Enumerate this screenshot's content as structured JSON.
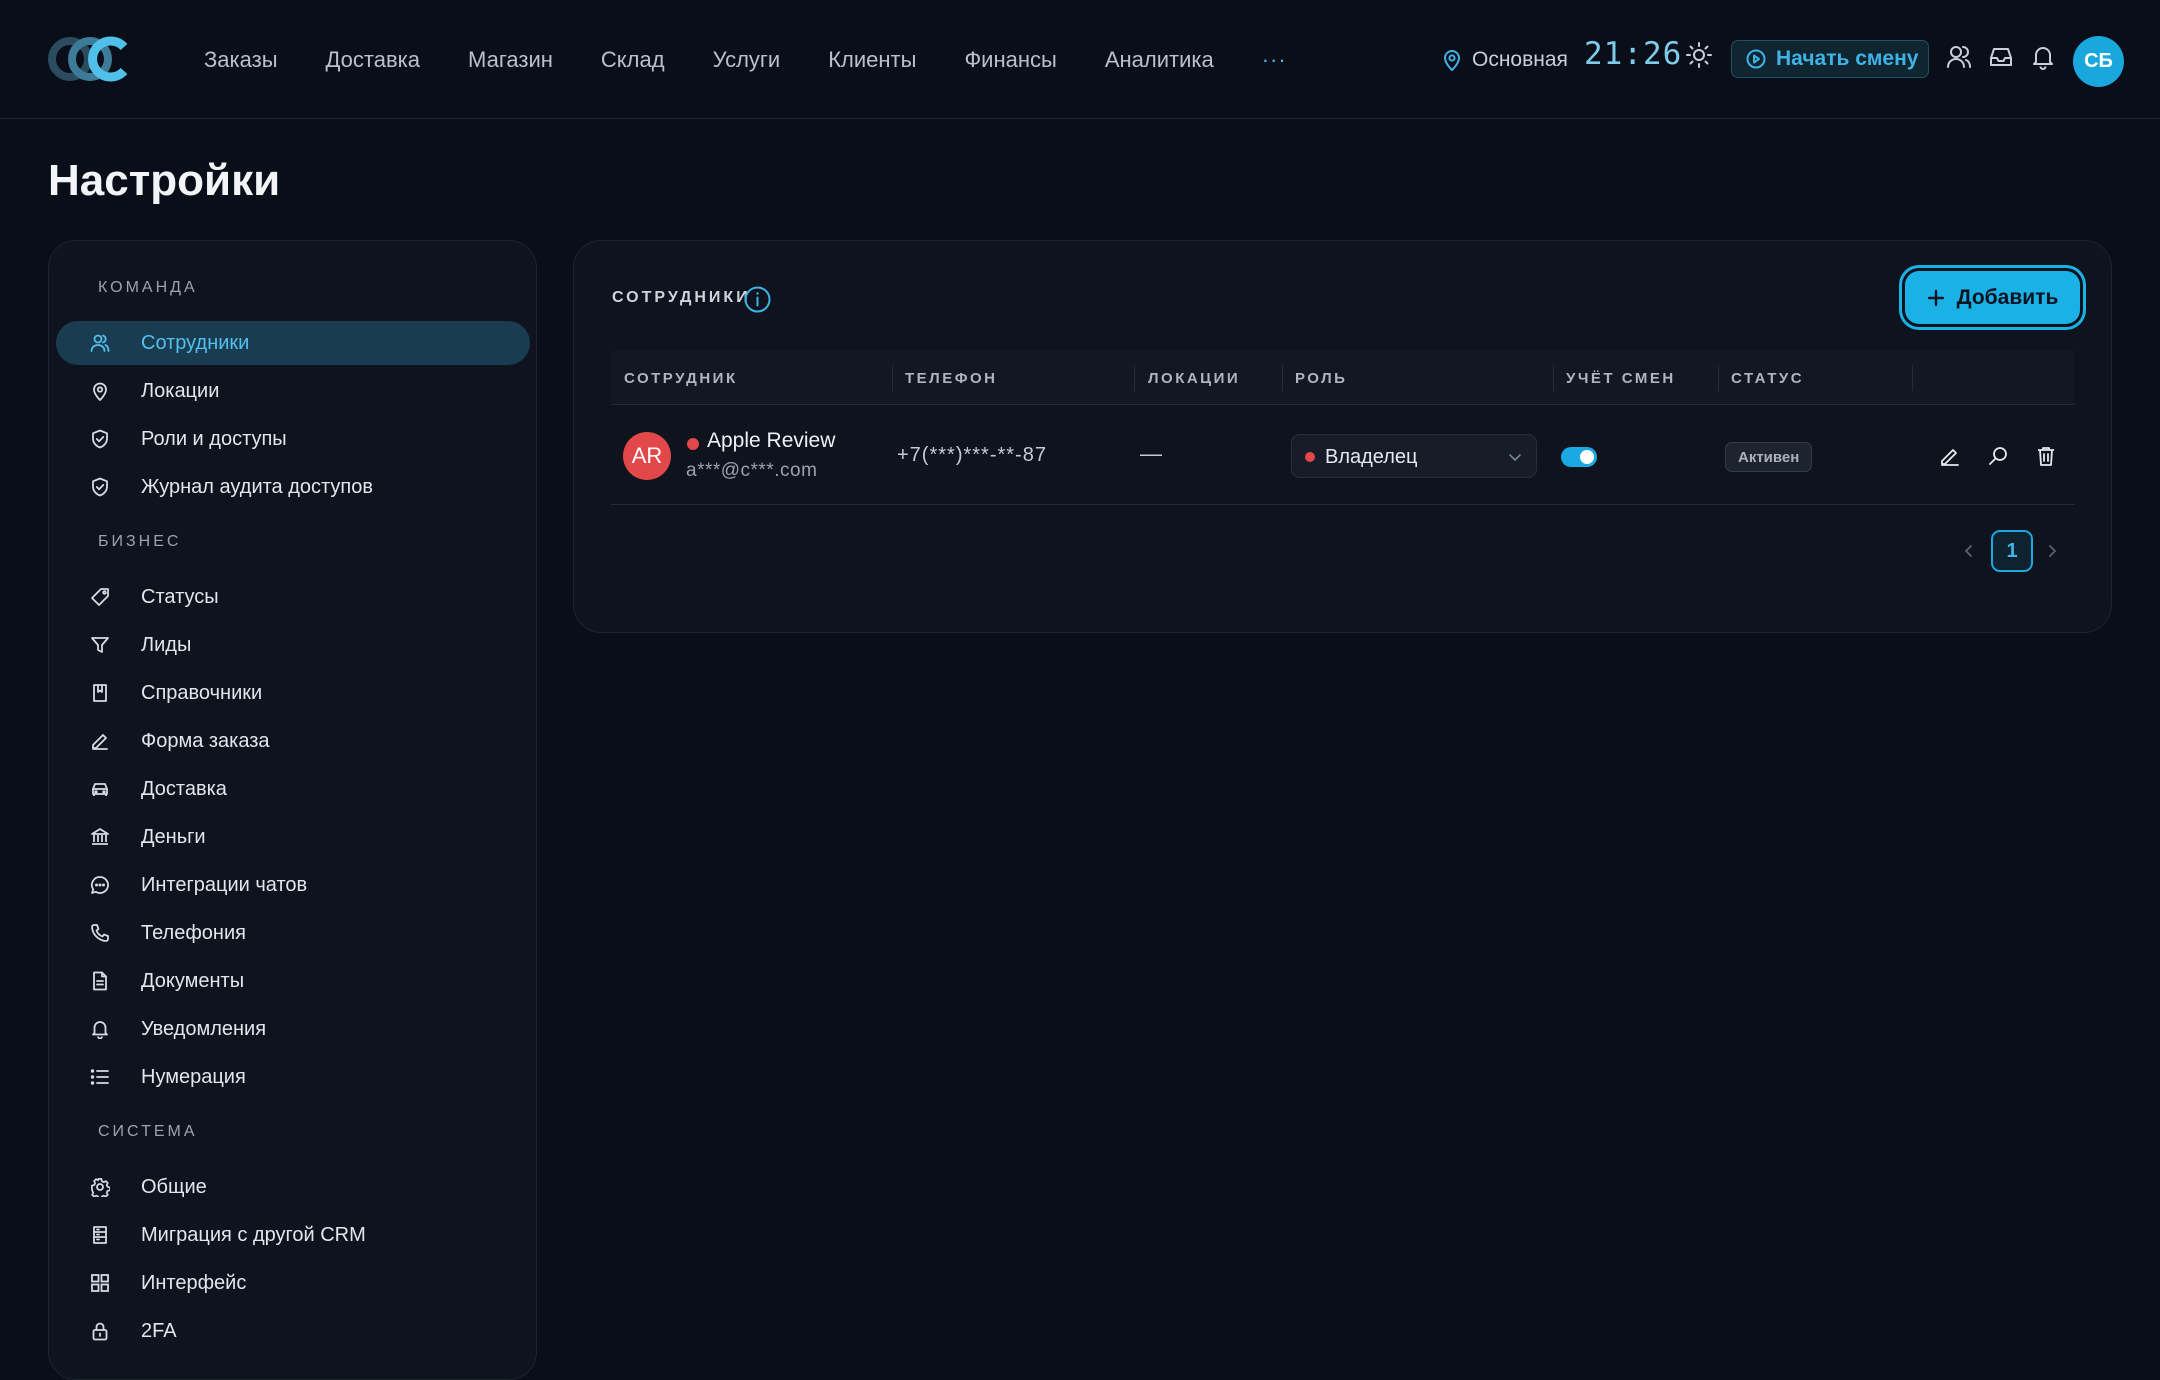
{
  "nav": {
    "items": [
      "Заказы",
      "Доставка",
      "Магазин",
      "Склад",
      "Услуги",
      "Клиенты",
      "Финансы",
      "Аналитика"
    ],
    "more": "···"
  },
  "header": {
    "location": "Основная",
    "clock": "21:26",
    "shift_button": "Начать смену",
    "user_initials": "СБ"
  },
  "page": {
    "title": "Настройки"
  },
  "sidebar": {
    "sections": [
      {
        "label": "КОМАНДА"
      },
      {
        "label": "БИЗНЕС"
      },
      {
        "label": "СИСТЕМА"
      }
    ],
    "items": [
      {
        "label": "Сотрудники",
        "icon": "users-icon",
        "active": true
      },
      {
        "label": "Локации",
        "icon": "map-pin-icon"
      },
      {
        "label": "Роли и доступы",
        "icon": "shield-check-icon"
      },
      {
        "label": "Журнал аудита доступов",
        "icon": "shield-check-icon"
      },
      {
        "label": "Статусы",
        "icon": "tag-icon"
      },
      {
        "label": "Лиды",
        "icon": "funnel-icon"
      },
      {
        "label": "Справочники",
        "icon": "book-icon"
      },
      {
        "label": "Форма заказа",
        "icon": "pencil-icon"
      },
      {
        "label": "Доставка",
        "icon": "car-icon"
      },
      {
        "label": "Деньги",
        "icon": "bank-icon"
      },
      {
        "label": "Интеграции чатов",
        "icon": "chat-icon"
      },
      {
        "label": "Телефония",
        "icon": "phone-icon"
      },
      {
        "label": "Документы",
        "icon": "document-icon"
      },
      {
        "label": "Уведомления",
        "icon": "bell-icon"
      },
      {
        "label": "Нумерация",
        "icon": "list-icon"
      },
      {
        "label": "Общие",
        "icon": "gear-icon"
      },
      {
        "label": "Миграция с другой CRM",
        "icon": "database-icon"
      },
      {
        "label": "Интерфейс",
        "icon": "grid-icon"
      },
      {
        "label": "2FA",
        "icon": "lock-icon"
      }
    ]
  },
  "panel": {
    "title": "СОТРУДНИКИ",
    "add_button": "Добавить",
    "columns": [
      "СОТРУДНИК",
      "ТЕЛЕФОН",
      "ЛОКАЦИИ",
      "РОЛЬ",
      "УЧЁТ СМЕН",
      "СТАТУС"
    ],
    "rows": [
      {
        "initials": "AR",
        "name": "Apple Review",
        "email": "a***@c***.com",
        "phone": "+7(***)***-**-87",
        "locations": "—",
        "role": "Владелец",
        "shift_tracking": true,
        "status": "Активен"
      }
    ],
    "pagination": {
      "current": "1"
    }
  },
  "colors": {
    "background": "#0a0e18",
    "accent": "#1ab1e7",
    "danger": "#e2474a"
  }
}
